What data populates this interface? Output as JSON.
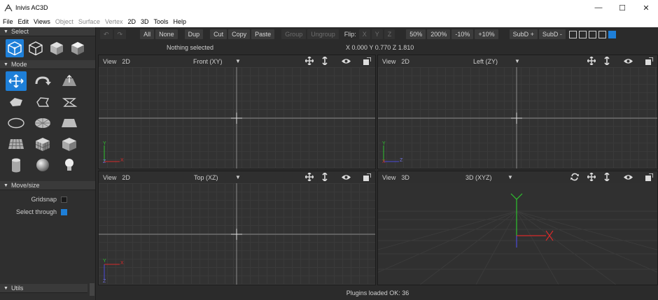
{
  "window": {
    "title": "Inivis AC3D",
    "minimize": "—",
    "maximize": "☐",
    "close": "✕"
  },
  "menu": [
    {
      "label": "File",
      "dim": false
    },
    {
      "label": "Edit",
      "dim": false
    },
    {
      "label": "Views",
      "dim": false
    },
    {
      "label": "Object",
      "dim": true
    },
    {
      "label": "Surface",
      "dim": true
    },
    {
      "label": "Vertex",
      "dim": true
    },
    {
      "label": "2D",
      "dim": false
    },
    {
      "label": "3D",
      "dim": false
    },
    {
      "label": "Tools",
      "dim": false
    },
    {
      "label": "Help",
      "dim": false
    }
  ],
  "panel": {
    "select_title": "Select",
    "mode_title": "Mode",
    "movesize_title": "Move/size",
    "utils_title": "Utils",
    "gridsnap_label": "Gridsnap",
    "gridsnap_checked": false,
    "selectthrough_label": "Select through",
    "selectthrough_checked": true
  },
  "toolbar": {
    "undo": "↶",
    "redo": "↷",
    "all": "All",
    "none": "None",
    "dup": "Dup",
    "cut": "Cut",
    "copy": "Copy",
    "paste": "Paste",
    "group": "Group",
    "ungroup": "Ungroup",
    "flip": "Flip:",
    "x": "X",
    "y": "Y",
    "z": "Z",
    "z50": "50%",
    "z200": "200%",
    "m10": "-10%",
    "p10": "+10%",
    "subdplus": "SubD +",
    "subdminus": "SubD -"
  },
  "info": {
    "selection": "Nothing selected",
    "coords": "X 0.000 Y 0.770 Z 1.810"
  },
  "viewports": {
    "front": {
      "view": "View",
      "mode": "2D",
      "name": "Front (XY)"
    },
    "left": {
      "view": "View",
      "mode": "2D",
      "name": "Left (ZY)"
    },
    "top": {
      "view": "View",
      "mode": "2D",
      "name": "Top (XZ)"
    },
    "persp": {
      "view": "View",
      "mode": "3D",
      "name": "3D (XYZ)"
    }
  },
  "axes": {
    "x": "X",
    "y": "Y",
    "z": "Z"
  },
  "colors": {
    "accent": "#1e7fd8",
    "axis_x": "#d62a2a",
    "axis_y": "#2ec22e",
    "axis_z": "#4b4bd8"
  },
  "status": "Plugins loaded OK: 36"
}
